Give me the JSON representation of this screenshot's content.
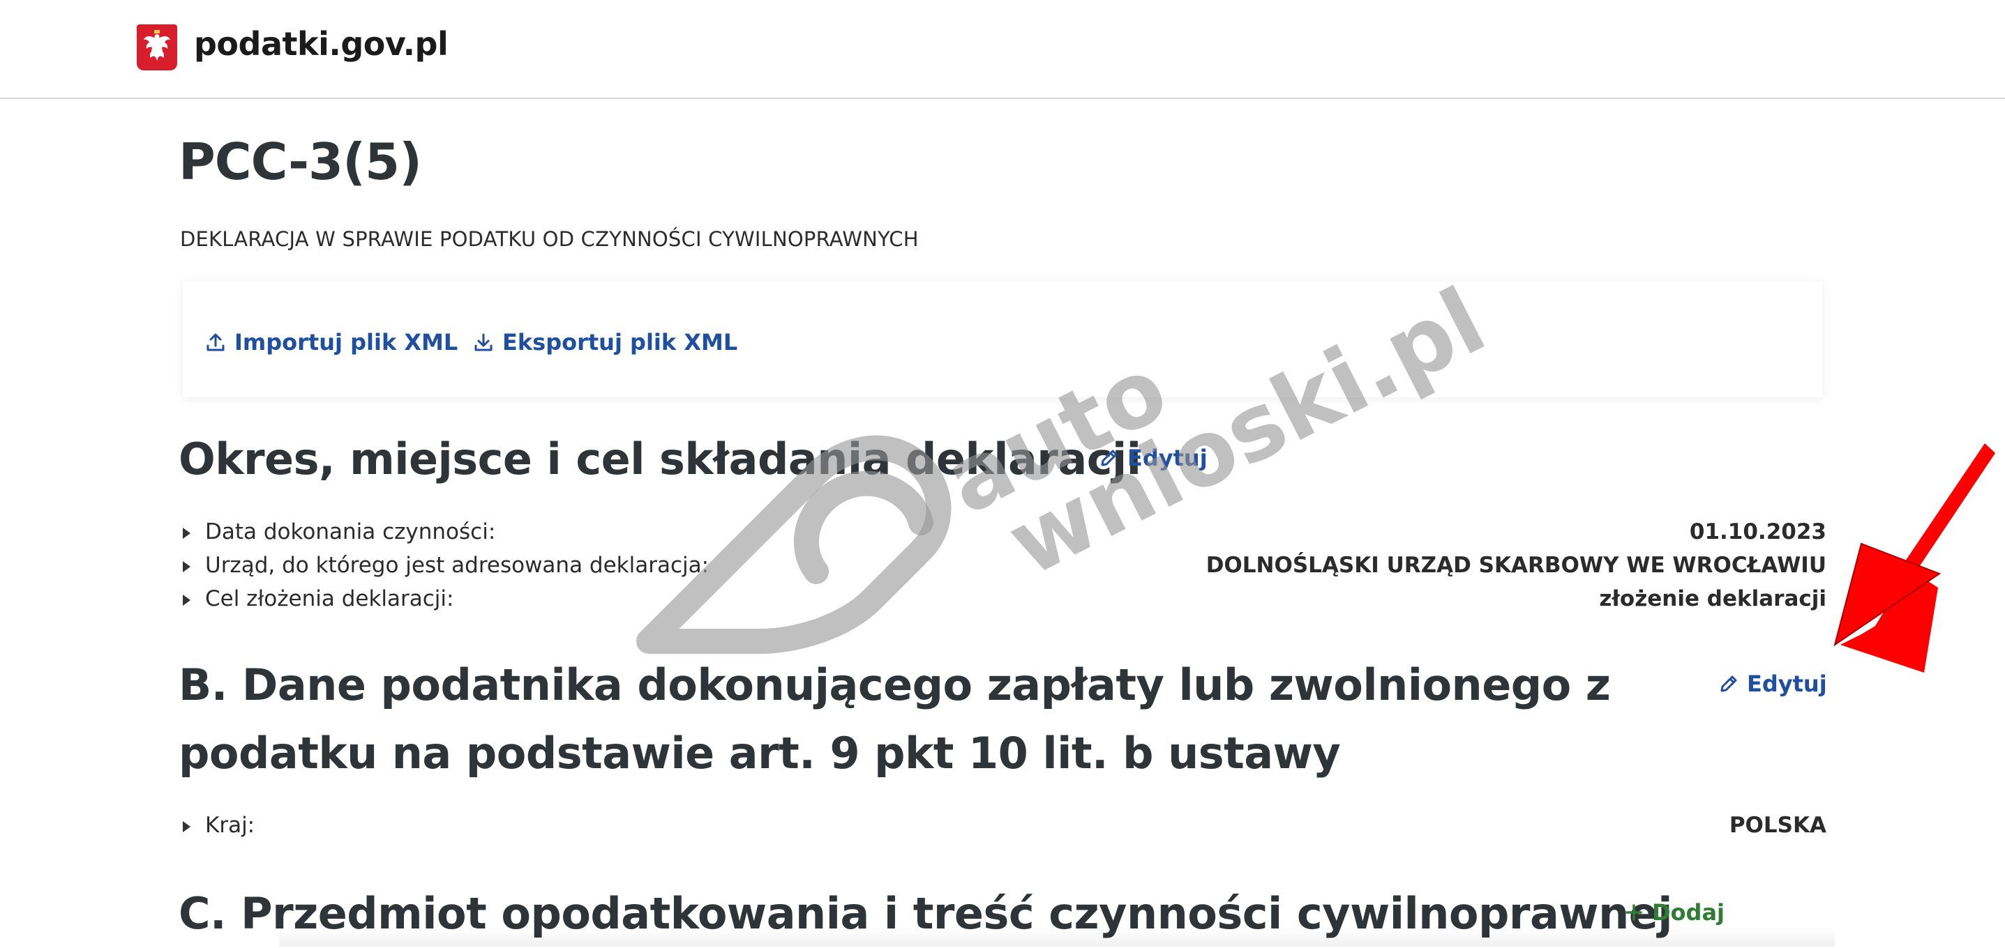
{
  "header": {
    "site_name": "podatki.gov.pl",
    "logo_icon": "polish-eagle-emblem"
  },
  "page": {
    "title": "PCC-3(5)",
    "subtitle": "DEKLARACJA W SPRAWIE PODATKU OD CZYNNOŚCI CYWILNOPRAWNYCH"
  },
  "xml_actions": {
    "import_label": "Importuj plik XML",
    "export_label": "Eksportuj plik XML"
  },
  "section_a": {
    "title": "Okres, miejsce i cel składania deklaracji",
    "edit_label": "Edytuj",
    "fields": [
      {
        "label": "Data dokonania czynności:",
        "value": "01.10.2023"
      },
      {
        "label": "Urząd, do którego jest adresowana deklaracja:",
        "value": "DOLNOŚLĄSKI URZĄD SKARBOWY WE WROCŁAWIU"
      },
      {
        "label": "Cel złożenia deklaracji:",
        "value": "złożenie deklaracji"
      }
    ]
  },
  "section_b": {
    "title_line1": "B. Dane podatnika dokonującego zapłaty lub zwolnionego z",
    "title_line2": "podatku na podstawie art. 9 pkt 10 lit. b ustawy",
    "edit_label": "Edytuj",
    "fields": [
      {
        "label": "Kraj:",
        "value": "POLSKA"
      }
    ]
  },
  "section_c": {
    "title": "C. Przedmiot opodatkowania i treść czynności cywilnoprawnej",
    "add_label": "Dodaj"
  },
  "watermark": {
    "line1": "auto",
    "line2": "wnioski.pl"
  },
  "colors": {
    "link_blue": "#1f4fa0",
    "add_green": "#2e7d32",
    "annotation_arrow": "#ff0000",
    "heading": "#2f3438"
  }
}
